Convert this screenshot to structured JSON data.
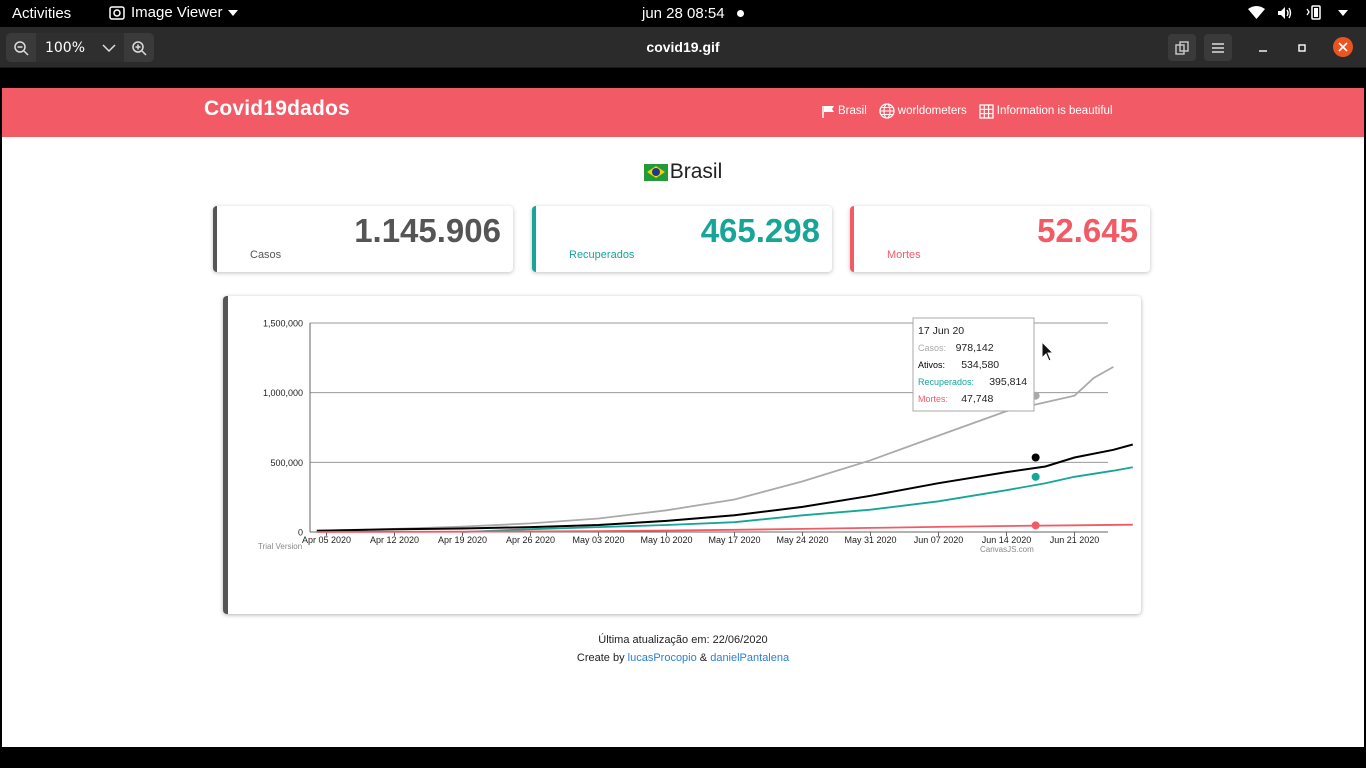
{
  "system_bar": {
    "activities": "Activities",
    "app_name": "Image Viewer",
    "clock": "jun 28  08:54"
  },
  "viewer": {
    "zoom": "100%",
    "title": "covid19.gif"
  },
  "site": {
    "brand": "Covid19dados",
    "nav": [
      {
        "label": "Brasil",
        "icon": "flag-icon"
      },
      {
        "label": "worldometers",
        "icon": "globe-icon"
      },
      {
        "label": "Information is beautiful",
        "icon": "grid-icon"
      }
    ],
    "country": "Brasil",
    "cards": [
      {
        "value": "1.145.906",
        "label": "Casos",
        "color": "#555555"
      },
      {
        "value": "465.298",
        "label": "Recuperados",
        "color": "#17a598"
      },
      {
        "value": "52.645",
        "label": "Mortes",
        "color": "#f25b66"
      }
    ],
    "footer_update": "Última atualização em: 22/06/2020",
    "footer_created": "Create by",
    "author1": "lucasProcopio",
    "amp": "&",
    "author2": "danielPantalena"
  },
  "chart_data": {
    "type": "line",
    "x": [
      "Apr 05 2020",
      "Apr 12 2020",
      "Apr 19 2020",
      "Apr 26 2020",
      "May 03 2020",
      "May 10 2020",
      "May 17 2020",
      "May 24 2020",
      "May 31 2020",
      "Jun 07 2020",
      "Jun 14 2020",
      "Jun 21 2020"
    ],
    "x_start_day": -1,
    "x_end_day": 79,
    "ylim": [
      0,
      1500000
    ],
    "y_ticks": [
      "0",
      "500,000",
      "1,000,000",
      "1,500,000"
    ],
    "grid": true,
    "series": [
      {
        "name": "Casos",
        "color": "#aaaaaa",
        "points": [
          [
            -1,
            10000
          ],
          [
            0,
            11130
          ],
          [
            7,
            22169
          ],
          [
            14,
            38654
          ],
          [
            21,
            61888
          ],
          [
            28,
            96559
          ],
          [
            35,
            155939
          ],
          [
            42,
            233142
          ],
          [
            49,
            363211
          ],
          [
            56,
            514849
          ],
          [
            63,
            691758
          ],
          [
            70,
            867624
          ],
          [
            77,
            978142
          ],
          [
            79,
            1106470
          ],
          [
            81,
            1185000
          ]
        ]
      },
      {
        "name": "Ativos",
        "color": "#000000",
        "points": [
          [
            -1,
            9000
          ],
          [
            0,
            10000
          ],
          [
            7,
            20000
          ],
          [
            14,
            25000
          ],
          [
            21,
            35000
          ],
          [
            28,
            50000
          ],
          [
            35,
            80000
          ],
          [
            42,
            120000
          ],
          [
            49,
            180000
          ],
          [
            56,
            260000
          ],
          [
            63,
            350000
          ],
          [
            70,
            430000
          ],
          [
            74,
            470000
          ],
          [
            77,
            534580
          ],
          [
            81,
            590000
          ],
          [
            83,
            628000
          ]
        ]
      },
      {
        "name": "Recuperados",
        "color": "#17a598",
        "points": [
          [
            14,
            0
          ],
          [
            21,
            20000
          ],
          [
            28,
            35000
          ],
          [
            35,
            50000
          ],
          [
            42,
            70000
          ],
          [
            49,
            120000
          ],
          [
            56,
            160000
          ],
          [
            63,
            220000
          ],
          [
            70,
            300000
          ],
          [
            74,
            350000
          ],
          [
            77,
            395814
          ],
          [
            81,
            440000
          ],
          [
            83,
            465298
          ]
        ]
      },
      {
        "name": "Mortes",
        "color": "#f25b66",
        "points": [
          [
            -1,
            200
          ],
          [
            7,
            1124
          ],
          [
            14,
            2462
          ],
          [
            21,
            4016
          ],
          [
            28,
            6750
          ],
          [
            35,
            10627
          ],
          [
            42,
            15633
          ],
          [
            49,
            22013
          ],
          [
            56,
            29314
          ],
          [
            63,
            36455
          ],
          [
            70,
            43332
          ],
          [
            77,
            47748
          ],
          [
            83,
            52645
          ]
        ]
      }
    ],
    "tooltip": {
      "date": "17 Jun 20",
      "rows": [
        {
          "label": "Casos:",
          "value": "978,142",
          "color": "#aaaaaa"
        },
        {
          "label": "Ativos:",
          "value": "534,580",
          "color": "#000000"
        },
        {
          "label": "Recuperados:",
          "value": "395,814",
          "color": "#17a598"
        },
        {
          "label": "Mortes:",
          "value": "47,748",
          "color": "#f25b66"
        }
      ]
    },
    "watermark_left": "Trial Version",
    "watermark_right": "CanvasJS.com"
  }
}
